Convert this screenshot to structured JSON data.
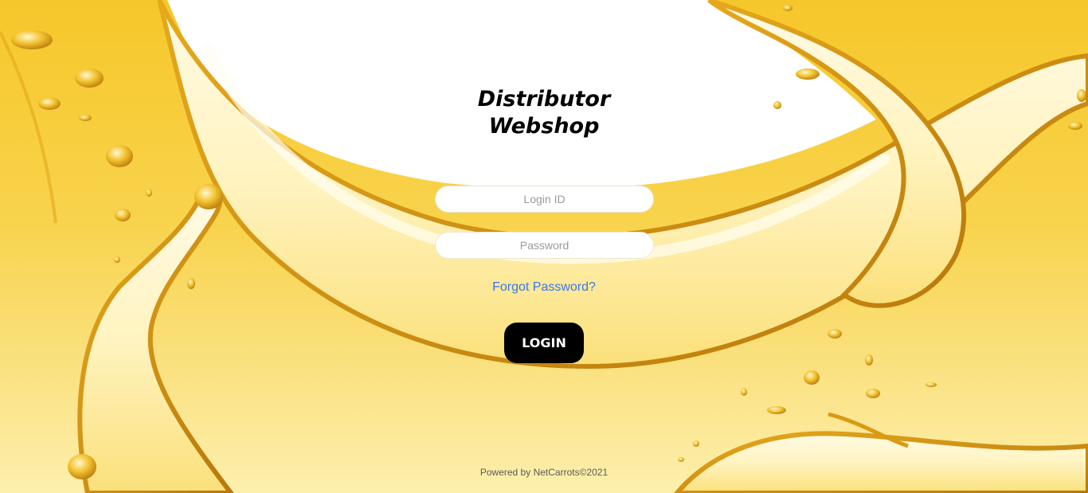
{
  "page": {
    "title": "Distributor Webshop"
  },
  "form": {
    "login_placeholder": "Login ID",
    "password_placeholder": "Password",
    "forgot_label": "Forgot Password?",
    "login_label": "LOGIN"
  },
  "footer": {
    "text": "Powered by NetCarrots©2021"
  },
  "colors": {
    "background_gold": "#f6c72a",
    "splash_light": "#fff6c8",
    "splash_dark": "#c98a10",
    "link": "#3b78e7",
    "button": "#000000"
  }
}
